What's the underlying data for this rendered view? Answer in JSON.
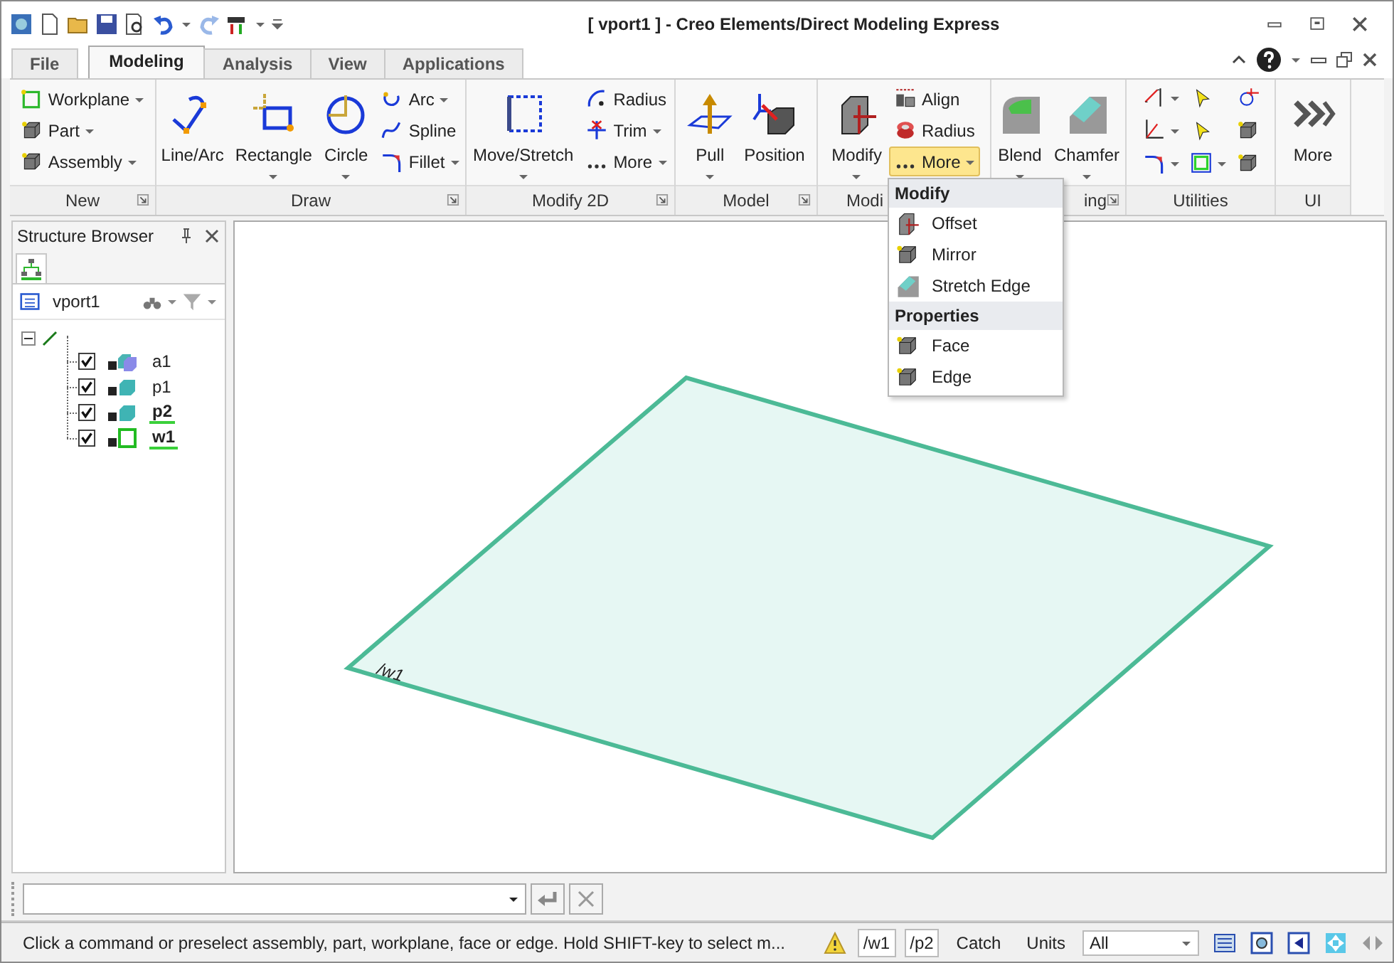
{
  "title_bar": {
    "title": "[ vport1 ] - Creo Elements/Direct Modeling Express"
  },
  "ribbon_tabs": [
    {
      "label": "File",
      "selected": false
    },
    {
      "label": "Modeling",
      "selected": true
    },
    {
      "label": "Analysis",
      "selected": false
    },
    {
      "label": "View",
      "selected": false
    },
    {
      "label": "Applications",
      "selected": false
    }
  ],
  "ribbon_groups": [
    {
      "label": "New",
      "launcher": true,
      "columns": [
        [
          {
            "kind": "small",
            "label": "Workplane",
            "dropdown": true,
            "active": false
          },
          {
            "kind": "small",
            "label": "Part",
            "dropdown": true,
            "active": false
          },
          {
            "kind": "small",
            "label": "Assembly",
            "dropdown": true,
            "active": false
          }
        ]
      ]
    },
    {
      "label": "Draw",
      "launcher": true,
      "columns": [
        [
          {
            "kind": "large",
            "label": "Line/Arc",
            "dropdown": false,
            "active": false
          }
        ],
        [
          {
            "kind": "large",
            "label": "Rectangle",
            "dropdown": true,
            "active": false
          }
        ],
        [
          {
            "kind": "large",
            "label": "Circle",
            "dropdown": true,
            "active": false
          }
        ],
        [
          {
            "kind": "small",
            "label": "Arc",
            "dropdown": true,
            "active": false
          },
          {
            "kind": "small",
            "label": "Spline",
            "dropdown": false,
            "active": false
          },
          {
            "kind": "small",
            "label": "Fillet",
            "dropdown": true,
            "active": false
          }
        ]
      ]
    },
    {
      "label": "Modify 2D",
      "launcher": true,
      "columns": [
        [
          {
            "kind": "large",
            "label": "Move/Stretch",
            "dropdown": true,
            "active": false
          }
        ],
        [
          {
            "kind": "small",
            "label": "Radius",
            "dropdown": false,
            "active": false
          },
          {
            "kind": "small",
            "label": "Trim",
            "dropdown": true,
            "active": false
          },
          {
            "kind": "small",
            "label": "More",
            "dropdown": true,
            "active": false
          }
        ]
      ]
    },
    {
      "label": "Model",
      "launcher": true,
      "columns": [
        [
          {
            "kind": "large",
            "label": "Pull",
            "dropdown": true,
            "active": false
          }
        ],
        [
          {
            "kind": "large",
            "label": "Position",
            "dropdown": false,
            "active": false
          }
        ]
      ]
    },
    {
      "label": "Modi",
      "launcher": false,
      "columns": [
        [
          {
            "kind": "large",
            "label": "Modify",
            "dropdown": true,
            "active": false
          }
        ],
        [
          {
            "kind": "small",
            "label": "Align",
            "dropdown": false,
            "active": false
          },
          {
            "kind": "small",
            "label": "Radius",
            "dropdown": false,
            "active": false
          },
          {
            "kind": "small",
            "label": "More",
            "dropdown": true,
            "active": true
          }
        ]
      ]
    },
    {
      "label": "ing",
      "launcher": true,
      "columns": [
        [
          {
            "kind": "large",
            "label": "Blend",
            "dropdown": true,
            "active": false
          }
        ],
        [
          {
            "kind": "large",
            "label": "Chamfer",
            "dropdown": true,
            "active": false
          }
        ]
      ]
    },
    {
      "label": "Utilities",
      "launcher": false,
      "columns": [
        [
          {
            "kind": "icon",
            "dropdown": true,
            "active": false
          },
          {
            "kind": "icon",
            "dropdown": true,
            "active": false
          },
          {
            "kind": "icon",
            "dropdown": true,
            "active": false
          }
        ],
        [
          {
            "kind": "icon",
            "dropdown": false,
            "active": false
          },
          {
            "kind": "icon",
            "dropdown": false,
            "active": false
          },
          {
            "kind": "icon",
            "dropdown": true,
            "active": false
          }
        ],
        [
          {
            "kind": "icon",
            "dropdown": false,
            "active": false
          },
          {
            "kind": "icon",
            "dropdown": false,
            "active": false
          },
          {
            "kind": "icon",
            "dropdown": false,
            "active": false
          }
        ]
      ]
    },
    {
      "label": "UI",
      "launcher": false,
      "columns": [
        [
          {
            "kind": "large",
            "label": "More",
            "dropdown": false,
            "active": false
          }
        ]
      ]
    }
  ],
  "dropdown_menu": {
    "sections": [
      {
        "header": "Modify",
        "items": [
          "Offset",
          "Mirror",
          "Stretch Edge"
        ]
      },
      {
        "header": "Properties",
        "items": [
          "Face",
          "Edge"
        ]
      }
    ]
  },
  "structure_browser": {
    "title": "Structure Browser",
    "viewport": "vport1",
    "tree": {
      "expanded": true,
      "children": [
        {
          "kind": "assembly",
          "label": "a1",
          "checked": true,
          "active": false
        },
        {
          "kind": "part",
          "label": "p1",
          "checked": true,
          "active": false
        },
        {
          "kind": "part",
          "label": "p2",
          "checked": true,
          "active": true
        },
        {
          "kind": "workplane",
          "label": "w1",
          "checked": true,
          "active": true
        }
      ]
    }
  },
  "viewport": {
    "workplane_label": "/w1"
  },
  "status_bar": {
    "message": "Click a command or preselect assembly, part, workplane, face or edge. Hold SHIFT-key to select m...",
    "current_workplane": "/w1",
    "current_part": "/p2",
    "catch": "Catch",
    "units": "Units",
    "filter": "All"
  }
}
